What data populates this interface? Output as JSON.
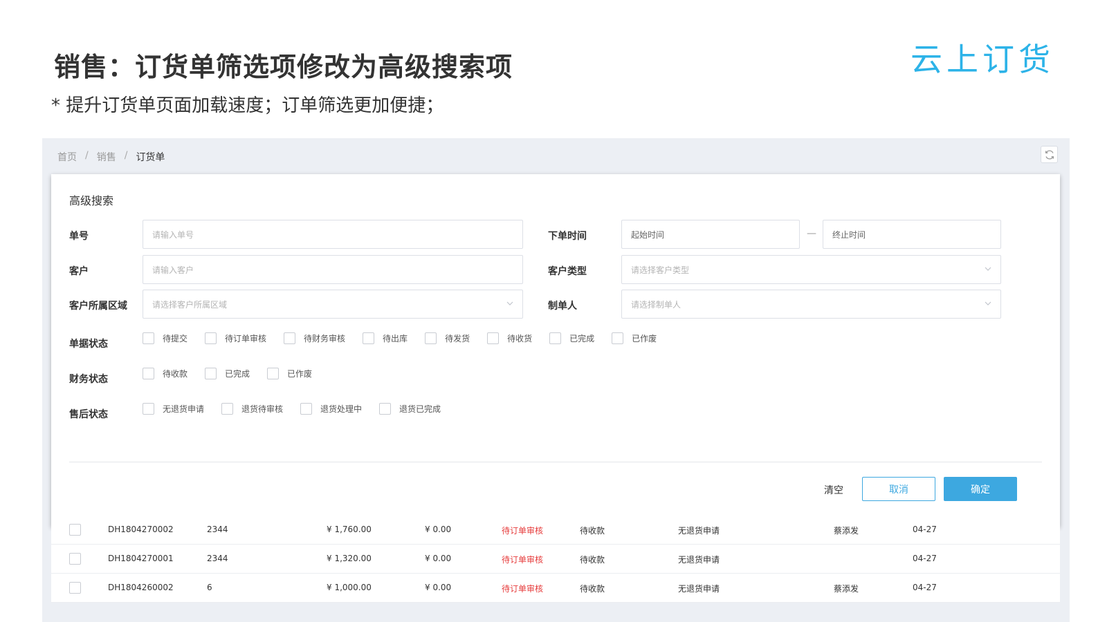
{
  "slide": {
    "title": "销售：订货单筛选项修改为高级搜索项",
    "subtitle": "* 提升订货单页面加载速度；订单筛选更加便捷；",
    "logo": "云上订货"
  },
  "breadcrumb": [
    "首页",
    "销售",
    "订货单"
  ],
  "breadcrumb_sep": "/",
  "search": {
    "title": "高级搜索",
    "order_no": {
      "label": "单号",
      "placeholder": "请输入单号"
    },
    "customer": {
      "label": "客户",
      "placeholder": "请输入客户"
    },
    "region": {
      "label": "客户所属区域",
      "placeholder": "请选择客户所属区域"
    },
    "order_time": {
      "label": "下单时间",
      "start_placeholder": "起始时间",
      "end_placeholder": "终止时间",
      "dash": "—"
    },
    "customer_type": {
      "label": "客户类型",
      "placeholder": "请选择客户类型"
    },
    "creator": {
      "label": "制单人",
      "placeholder": "请选择制单人"
    },
    "doc_status": {
      "label": "单据状态",
      "options": [
        "待提交",
        "待订单审核",
        "待财务审核",
        "待出库",
        "待发货",
        "待收货",
        "已完成",
        "已作废"
      ]
    },
    "finance_status": {
      "label": "财务状态",
      "options": [
        "待收款",
        "已完成",
        "已作废"
      ]
    },
    "aftersale_status": {
      "label": "售后状态",
      "options": [
        "无退货申请",
        "退货待审核",
        "退货处理中",
        "退货已完成"
      ]
    },
    "clear_label": "清空",
    "cancel_label": "取消",
    "ok_label": "确定"
  },
  "colors": {
    "accent": "#3da8e0",
    "logo": "#2db3e8",
    "status_red": "#e63b3b"
  },
  "table": {
    "rows": [
      {
        "order_no": "DH1804270002",
        "customer": "2344",
        "amount": "¥ 1,760.00",
        "paid": "¥ 0.00",
        "status": "待订单审核",
        "finance": "待收款",
        "aftersale": "无退货申请",
        "creator": "蔡添发",
        "date": "04-27"
      },
      {
        "order_no": "DH1804270001",
        "customer": "2344",
        "amount": "¥ 1,320.00",
        "paid": "¥ 0.00",
        "status": "待订单审核",
        "finance": "待收款",
        "aftersale": "无退货申请",
        "creator": "",
        "date": "04-27"
      },
      {
        "order_no": "DH1804260002",
        "customer": "6",
        "amount": "¥ 1,000.00",
        "paid": "¥ 0.00",
        "status": "待订单审核",
        "finance": "待收款",
        "aftersale": "无退货申请",
        "creator": "蔡添发",
        "date": "04-27"
      }
    ]
  }
}
